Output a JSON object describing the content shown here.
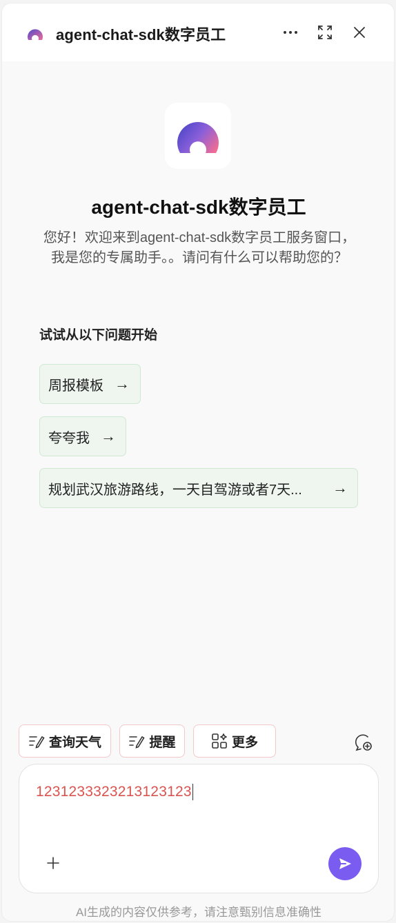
{
  "header": {
    "title": "agent-chat-sdk数字员工",
    "icons": [
      "more-icon",
      "fullscreen-icon",
      "close-icon"
    ]
  },
  "intro": {
    "name": "agent-chat-sdk数字员工",
    "welcome": "您好！欢迎来到agent-chat-sdk数字员工服务窗口，我是您的专属助手。。请问有什么可以帮助您的？"
  },
  "suggestions": {
    "title": "试试从以下问题开始",
    "items": [
      {
        "label": "周报模板",
        "arrow": "→"
      },
      {
        "label": "夸夸我",
        "arrow": "→"
      },
      {
        "label": "规划武汉旅游路线，一天自驾游或者7天...",
        "arrow": "→"
      }
    ]
  },
  "tools": [
    {
      "label": "查询天气",
      "icon": "edit-lines-icon"
    },
    {
      "label": "提醒",
      "icon": "edit-lines-icon"
    },
    {
      "label": "更多",
      "icon": "apps-icon"
    }
  ],
  "composer": {
    "value": "123123332321312312​3",
    "send_icon": "send-icon",
    "add_icon": "plus-icon"
  },
  "footer": {
    "disclaimer": "AI生成的内容仅供参考，请注意甄别信息准确性"
  },
  "colors": {
    "accent": "#7b5cf0",
    "suggestion_bg": "#eef6ef",
    "suggestion_border": "#cfe8d3",
    "tool_border": "#f4c7c9",
    "input_text": "#d9534f"
  }
}
